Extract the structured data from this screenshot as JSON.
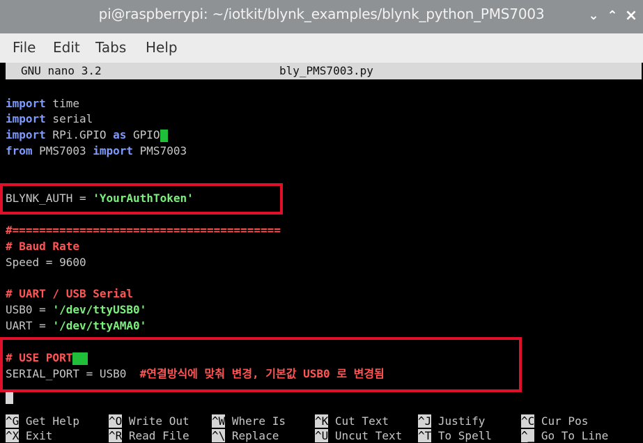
{
  "window": {
    "title": "pi@raspberrypi: ~/iotkit/blynk_examples/blynk_python_PMS7003",
    "buttons": {
      "minimize": "⌄",
      "maximize": "⌃",
      "close": "×"
    }
  },
  "menu": {
    "file": "File",
    "edit": "Edit",
    "tabs": "Tabs",
    "help": "Help"
  },
  "nano": {
    "version": "GNU nano 3.2",
    "filename": "bly_PMS7003.py"
  },
  "code": {
    "l1": {
      "kw": "import",
      "rest": " time"
    },
    "l2": {
      "kw": "import",
      "rest": " serial"
    },
    "l3": {
      "kw1": "import",
      "mid": " RPi.GPIO ",
      "kw2": "as",
      "rest": " GPIO"
    },
    "l4": {
      "kw1": "from",
      "mid": " PMS7003 ",
      "kw2": "import",
      "rest": " PMS7003"
    },
    "l5": {
      "text": "BLYNK_AUTH = ",
      "str": "'YourAuthToken'"
    },
    "l6": {
      "cm": "#========================================"
    },
    "l7": {
      "cm": "# Baud Rate"
    },
    "l8": {
      "text": "Speed = 9600"
    },
    "l9": {
      "cm": "# UART / USB Serial"
    },
    "l10": {
      "text": "USB0 = ",
      "str": "'/dev/ttyUSB0'"
    },
    "l11": {
      "text": "UART = ",
      "str": "'/dev/ttyAMA0'"
    },
    "l12": {
      "cm": "# USE PORT"
    },
    "l13": {
      "text": "SERIAL_PORT = USB0  ",
      "cm": "#연결방식에 맞춰 변경, 기본값 USB0 로 변경됨"
    }
  },
  "shortcuts": [
    {
      "key": "^G",
      "label": " Get Help"
    },
    {
      "key": "^O",
      "label": " Write Out"
    },
    {
      "key": "^W",
      "label": " Where Is"
    },
    {
      "key": "^K",
      "label": " Cut Text"
    },
    {
      "key": "^J",
      "label": " Justify"
    },
    {
      "key": "^C",
      "label": " Cur Pos"
    },
    {
      "key": "^X",
      "label": " Exit"
    },
    {
      "key": "^R",
      "label": " Read File"
    },
    {
      "key": "^\\",
      "label": " Replace"
    },
    {
      "key": "^U",
      "label": " Uncut Text"
    },
    {
      "key": "^T",
      "label": " To Spell"
    },
    {
      "key": "^_",
      "label": " Go To Line"
    }
  ],
  "colors": {
    "titlebar": "#8f9295",
    "keyword": "#7d9bff",
    "string": "#7cf07c",
    "comment": "#ff5555",
    "cursor": "#1fbf3a",
    "highlight_box": "#e0102a"
  }
}
